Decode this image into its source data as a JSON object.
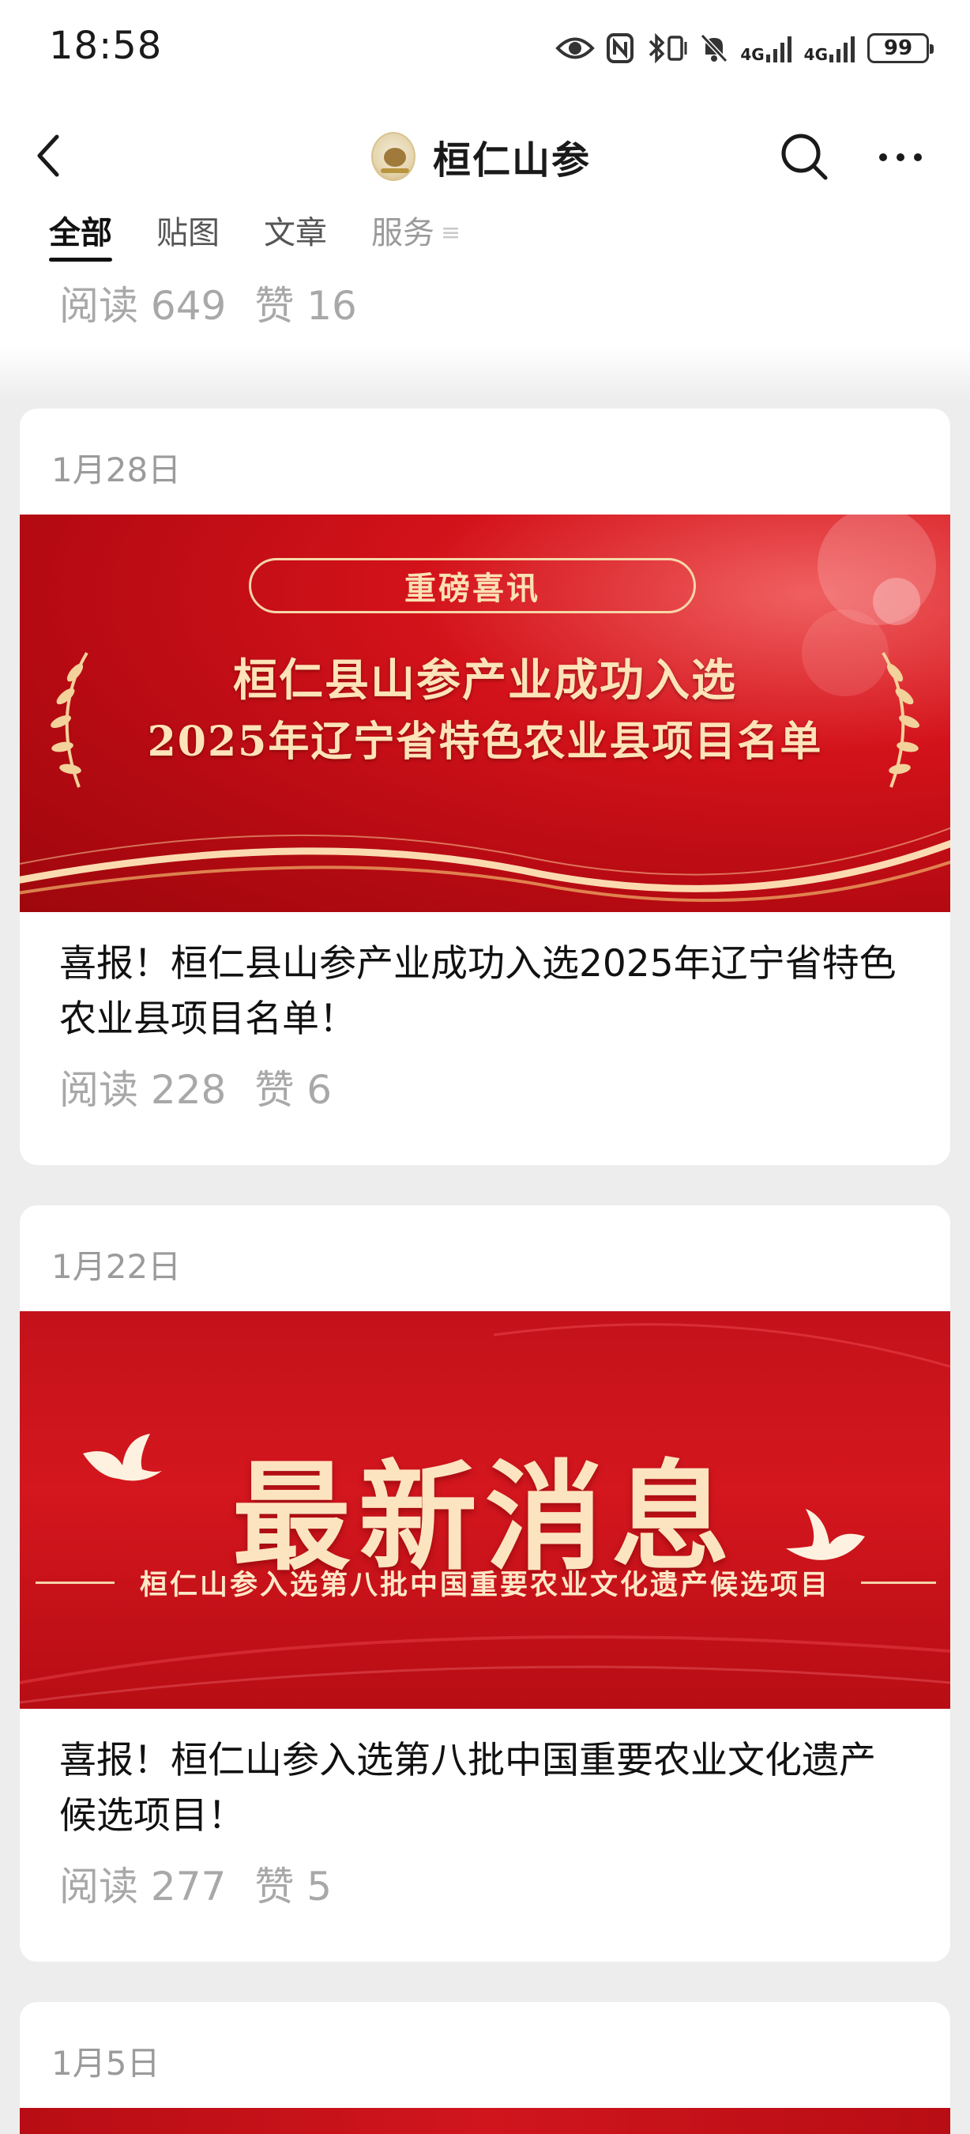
{
  "status_bar": {
    "time": "18:58",
    "battery": "99",
    "signal_label": "4G",
    "icons": [
      "eye-icon",
      "nfc-icon",
      "bluetooth-vibrate-icon",
      "mute-icon",
      "signal-4g-icon",
      "signal-4g-icon",
      "battery-icon"
    ]
  },
  "header": {
    "title": "桓仁山参",
    "back_icon": "chevron-left-icon",
    "search_icon": "search-icon",
    "more_icon": "more-horizontal-icon"
  },
  "tabs": [
    {
      "label": "全部",
      "active": true
    },
    {
      "label": "贴图",
      "active": false
    },
    {
      "label": "文章",
      "active": false
    },
    {
      "label": "服务",
      "active": false
    }
  ],
  "tabs_more_icon": "≡",
  "previous_post": {
    "reads": "阅读 649",
    "likes": "赞 16"
  },
  "posts": [
    {
      "date": "1月28日",
      "banner": {
        "pill": "重磅喜讯",
        "line1": "桓仁县山参产业成功入选",
        "line2": "2025年辽宁省特色农业县项目名单"
      },
      "title": "喜报！桓仁县山参产业成功入选2025年辽宁省特色农业县项目名单！",
      "reads": "阅读 228",
      "likes": "赞 6"
    },
    {
      "date": "1月22日",
      "banner": {
        "headline": "最新消息",
        "subtitle": "桓仁山参入选第八批中国重要农业文化遗产候选项目"
      },
      "title": "喜报！桓仁山参入选第八批中国重要农业文化遗产候选项目！",
      "reads": "阅读 277",
      "likes": "赞 5"
    },
    {
      "date": "1月5日"
    }
  ],
  "colors": {
    "banner_red": "#c4121a",
    "banner_gold": "#fde3b8",
    "page_bg": "#ededed",
    "muted_text": "#a8a8a8"
  }
}
